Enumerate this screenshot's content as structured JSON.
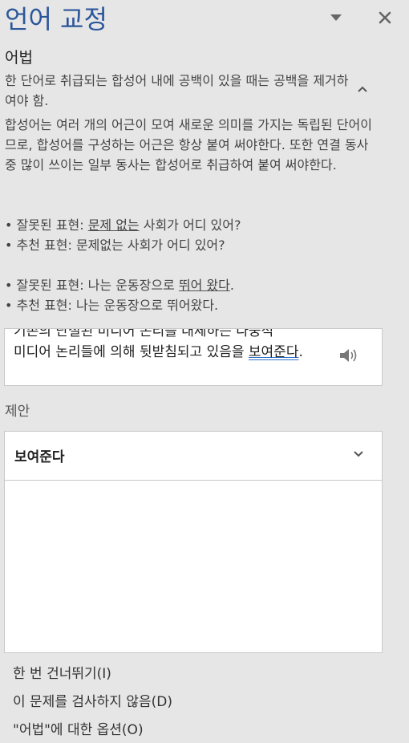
{
  "header": {
    "title": "언어 교정"
  },
  "issue": {
    "category": "어법",
    "summary": "한 단어로 취급되는 합성어 내에 공백이 있을 때는 공백을 제거하여야 함.",
    "explanation": "합성어는 여러 개의 어근이 모여 새로운 의미를 가지는 독립된 단어이므로, 합성어를 구성하는 어근은 항상 붙여 써야한다. 또한 연결 동사 중 많이 쓰이는 일부 동사는 합성어로 취급하여 붙여 써야한다.",
    "examples": [
      {
        "wrong_prefix": "• 잘못된 표현: ",
        "wrong_underlined": "문제 없는",
        "wrong_suffix": " 사회가 어디 있어?",
        "right": "• 추천 표현: 문제없는 사회가 어디 있어?"
      },
      {
        "wrong_prefix": "• 잘못된 표현: 나는 운동장으로 ",
        "wrong_underlined": "뛰어 왔다",
        "wrong_suffix": ".",
        "right": "• 추천 표현: 나는 운동장으로 뛰어왔다."
      }
    ]
  },
  "context": {
    "line_top": "기존의 단절된 미디어 논리를 대체하는 다중적",
    "line_before": "미디어 논리들에 의해 뒷받침되고 있음을 ",
    "flagged": "보여준다",
    "line_after": "."
  },
  "suggestions": {
    "label": "제안",
    "items": [
      "보여준다"
    ]
  },
  "actions": {
    "ignore_once": "한 번 건너뛰기(I)",
    "dont_check": "이 문제를 검사하지 않음(D)",
    "options": "\"어법\"에 대한 옵션(O)"
  }
}
